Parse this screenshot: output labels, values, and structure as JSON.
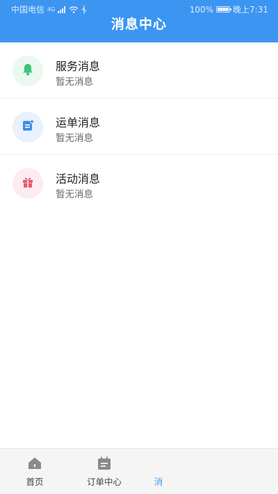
{
  "status_bar": {
    "carrier": "中国电信",
    "network": "4G",
    "battery": "100%",
    "time": "晚上7:31"
  },
  "header": {
    "title": "消息中心"
  },
  "messages": [
    {
      "title": "服务消息",
      "subtitle": "暂无消息",
      "icon": "bell-icon",
      "icon_color": "#3dc37a",
      "bg_color": "#eaf8ef"
    },
    {
      "title": "运单消息",
      "subtitle": "暂无消息",
      "icon": "waybill-icon",
      "icon_color": "#3d8fe6",
      "bg_color": "#e8f1fc"
    },
    {
      "title": "活动消息",
      "subtitle": "暂无消息",
      "icon": "gift-icon",
      "icon_color": "#e45b6e",
      "bg_color": "#fcecef"
    }
  ],
  "tabbar": {
    "items": [
      {
        "label": "首页",
        "icon": "home-icon"
      },
      {
        "label": "订单中心",
        "icon": "calendar-icon"
      },
      {
        "label": "消",
        "icon": "message-icon",
        "active": true
      }
    ]
  },
  "colors": {
    "brand": "#3d95f2",
    "inactive_tab": "#8a8a8a"
  }
}
